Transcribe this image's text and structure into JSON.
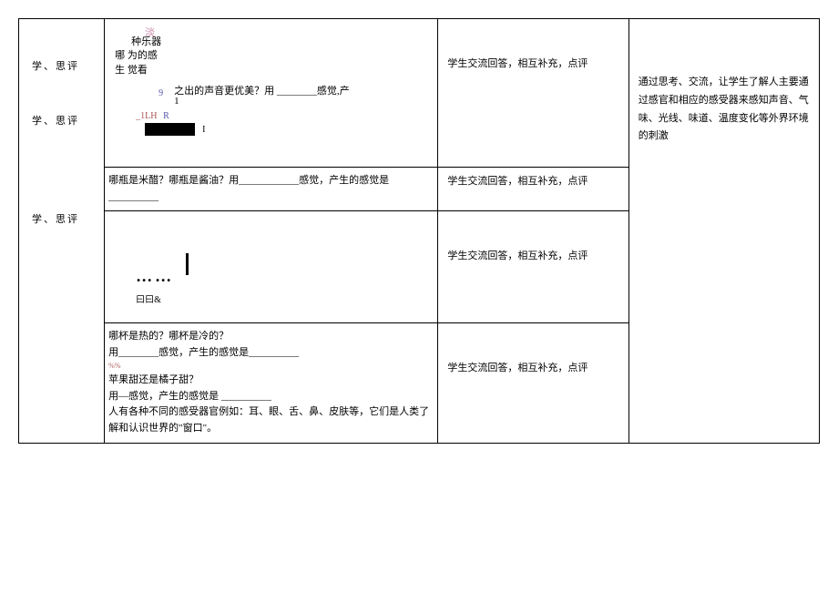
{
  "col1": {
    "label": "学、思评"
  },
  "section1": {
    "faded": "淡",
    "instrument": "种乐器",
    "why": "为的感",
    "which": "哪",
    "sense": "觉看",
    "n9": "9",
    "question": "之出的声音更优美？用 ________感觉,产",
    "n1": "1",
    "lh": "_1LH",
    "r": "R",
    "afterBlack": "I"
  },
  "section2": {
    "question": "哪瓶是米醋？哪瓶是酱油？用____________感觉，产生的感觉是__________"
  },
  "section3": {
    "dots": "……",
    "riri": "曰曰&"
  },
  "section4": {
    "q1": "哪杯是热的？哪杯是冷的？",
    "q2": "用________感觉，产生的感觉是__________",
    "percent": "%%",
    "q3": "苹果甜还是橘子甜？",
    "q4": "用―感觉，产生的感觉是 __________",
    "note1": "人有各种不同的感受器官例如：耳、眼、舌、鼻、皮肤等，它们是人类了解和认识世界的\"窗口\"。"
  },
  "col3": {
    "response": "学生交流回答，相互补充，点评"
  },
  "col4": {
    "summary": "通过思考、交流，让学生了解人主要通过感官和相应的感受器来感知声音、气味、光线、味道、温度变化等外界环境的刺激"
  }
}
